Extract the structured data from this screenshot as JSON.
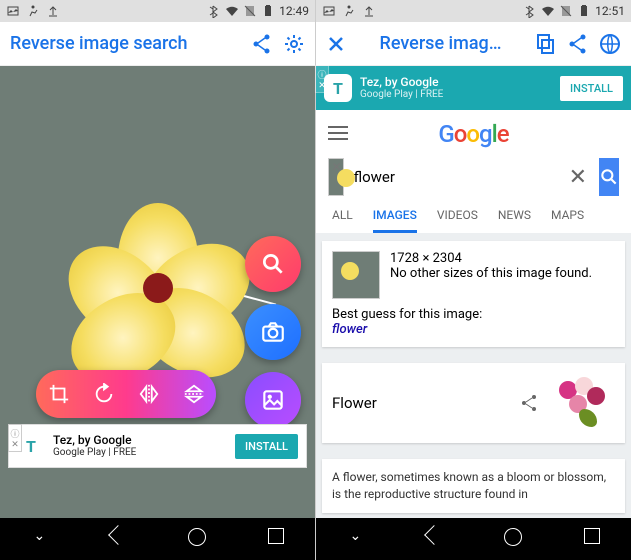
{
  "left": {
    "status": {
      "time": "12:49"
    },
    "appbar": {
      "title": "Reverse image search"
    },
    "ad": {
      "title": "Tez, by Google",
      "sub": "Google Play  |  FREE",
      "cta": "INSTALL"
    }
  },
  "right": {
    "status": {
      "time": "12:51"
    },
    "appbar": {
      "title": "Reverse imag…"
    },
    "ad": {
      "title": "Tez, by Google",
      "sub": "Google Play  |  FREE",
      "cta": "INSTALL"
    },
    "google_logo": [
      "G",
      "o",
      "o",
      "g",
      "l",
      "e"
    ],
    "search": {
      "value": "flower"
    },
    "tabs": [
      "ALL",
      "IMAGES",
      "VIDEOS",
      "NEWS",
      "MAPS"
    ],
    "tabs_active": 1,
    "result1": {
      "dims": "1728 × 2304",
      "msg": "No other sizes of this image found.",
      "guess_label": "Best guess for this image:",
      "guess": "flower"
    },
    "result2": {
      "title": "Flower"
    },
    "result3": {
      "text": "A flower, sometimes known as a bloom or blossom, is the reproductive structure found in"
    }
  }
}
